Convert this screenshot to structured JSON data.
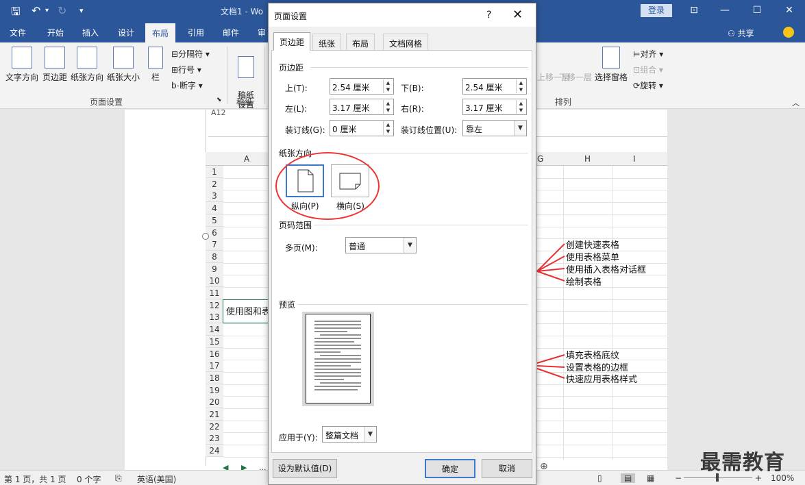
{
  "window": {
    "doc_title": "文档1 - Wo",
    "login": "登录"
  },
  "menu": {
    "tabs": [
      "文件",
      "开始",
      "插入",
      "设计",
      "布局",
      "引用",
      "邮件",
      "审"
    ],
    "active": "布局",
    "share": "共享"
  },
  "ribbon": {
    "text_direction": "文字方向",
    "margins": "页边距",
    "orientation": "纸张方向",
    "size": "纸张大小",
    "columns": "栏",
    "breaks": "分隔符",
    "line_numbers": "行号",
    "hyphenation": "断字",
    "page_setup_group": "页面设置",
    "draft_setup": "稿纸\n设置",
    "draft_group": "稿纸",
    "bring_forward": "上移一层",
    "send_backward": "下移一层",
    "selection_pane": "选择窗格",
    "align": "对齐",
    "group": "组合",
    "rotate": "旋转",
    "arrange_group": "排列"
  },
  "sheet": {
    "name_box": "A12",
    "columns": [
      "A",
      "G",
      "H",
      "I"
    ],
    "rows": [
      "1",
      "2",
      "3",
      "4",
      "5",
      "6",
      "7",
      "8",
      "9",
      "10",
      "11",
      "12",
      "13",
      "14",
      "15",
      "16",
      "17",
      "18",
      "19",
      "20",
      "21",
      "22",
      "23",
      "24"
    ],
    "cell_a12": "使用图和表",
    "notes_top": [
      "创建快速表格",
      "使用表格菜单",
      "使用插入表格对话框",
      "绘制表格"
    ],
    "notes_bottom": [
      "填充表格底纹",
      "设置表格的边框",
      "快速应用表格样式"
    ],
    "sheet_nav": "..."
  },
  "status": {
    "page": "第 1 页，共 1 页",
    "words": "0 个字",
    "lang": "英语(美国)",
    "zoom": "100%"
  },
  "watermark": "最需教育",
  "dialog": {
    "title": "页面设置",
    "help": "?",
    "close": "✕",
    "tabs": [
      "页边距",
      "纸张",
      "布局",
      "文档网格"
    ],
    "active_tab": "页边距",
    "margins_section": "页边距",
    "top_label": "上(T):",
    "top_value": "2.54 厘米",
    "bottom_label": "下(B):",
    "bottom_value": "2.54 厘米",
    "left_label": "左(L):",
    "left_value": "3.17 厘米",
    "right_label": "右(R):",
    "right_value": "3.17 厘米",
    "gutter_label": "装订线(G):",
    "gutter_value": "0 厘米",
    "gutter_pos_label": "装订线位置(U):",
    "gutter_pos_value": "靠左",
    "orientation_section": "纸张方向",
    "portrait": "纵向(P)",
    "landscape": "横向(S)",
    "pages_section": "页码范围",
    "multiple_pages_label": "多页(M):",
    "multiple_pages_value": "普通",
    "preview_section": "预览",
    "apply_label": "应用于(Y):",
    "apply_value": "整篇文档",
    "set_default": "设为默认值(D)",
    "ok": "确定",
    "cancel": "取消"
  },
  "colors": {
    "word_blue": "#2b579a",
    "excel_green": "#217346",
    "highlight_red": "#e33333",
    "selection_blue": "#3a78c8"
  }
}
